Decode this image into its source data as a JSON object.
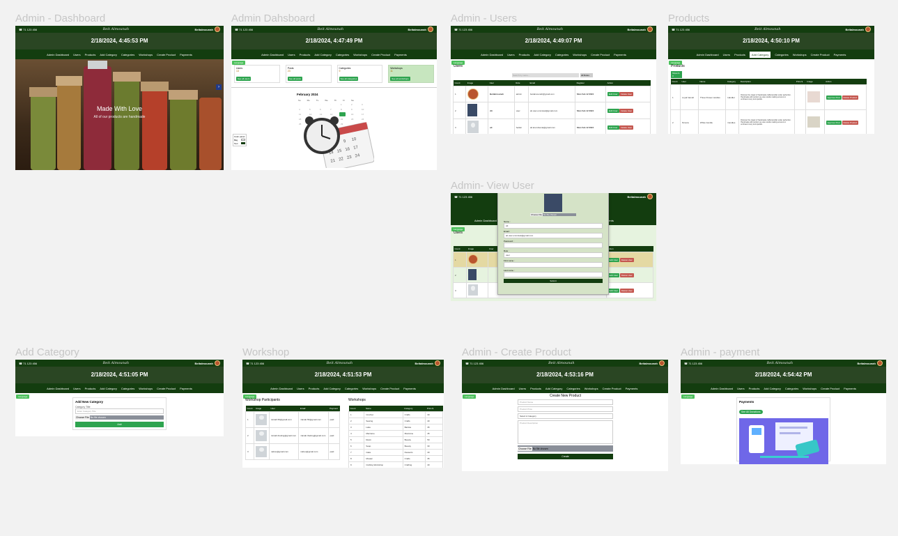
{
  "frames": {
    "dashboard": "Admin - Dashboard",
    "dahsboard": "Admin Dahsboard",
    "users": "Admin - Users",
    "products": "Products",
    "view_user": "Admin- View User",
    "add_category": "Add Category",
    "workshop": "Workshop",
    "create_product": "Admin - Create Product",
    "payment": "Admin - payment"
  },
  "common": {
    "phone": "71 123 456",
    "logo": "Beit Almounah",
    "username": "Beitalmounah",
    "lang": "Language"
  },
  "times": {
    "dashboard": "2/18/2024, 4:45:53 PM",
    "dahsboard": "2/18/2024, 4:47:49 PM",
    "users": "2/18/2024, 4:49:07 PM",
    "products": "2/18/2024, 4:50:10 PM",
    "add_category": "2/18/2024, 4:51:05 PM",
    "workshop": "2/18/2024, 4:51:53 PM",
    "create_product": "2/18/2024, 4:53:16 PM",
    "payment": "2/18/2024, 4:54:42 PM"
  },
  "nav": [
    "Admin Dashboard",
    "Users",
    "Products",
    "Add Category",
    "Categories",
    "Workshops",
    "Create Product",
    "Payments"
  ],
  "nav_alt_first": "Admin Dashboard",
  "hero": {
    "title": "Made With Love",
    "subtitle": "All of our products are handmade"
  },
  "stats": [
    {
      "label": "Users",
      "value": "13",
      "btn": "See all users"
    },
    {
      "label": "Posts",
      "value": "23",
      "btn": "See all posts"
    },
    {
      "label": "Categories",
      "value": "9",
      "btn": "See all categories"
    },
    {
      "label": "Workshops",
      "value": "11",
      "btn": "See all workshops"
    }
  ],
  "calendar": {
    "month": "February 2024",
    "days": [
      "Su",
      "Mo",
      "Tu",
      "We",
      "Th",
      "Fr",
      "Sa"
    ]
  },
  "color_panel": {
    "title": "Color panel",
    "rows": [
      "Bkg",
      "Text"
    ]
  },
  "users_page": {
    "heading": "Users",
    "search_placeholder": "Search by name...",
    "filter_btn": "All Roles",
    "columns": [
      "Count",
      "Image",
      "User",
      "Role",
      "Email",
      "Register",
      "Action"
    ],
    "rows": [
      {
        "count": "1",
        "user": "Beitalmounah",
        "role": "admin",
        "email": "beitalmounah@gmail.com",
        "date": "Mon Feb 12 2024"
      },
      {
        "count": "2",
        "user": "Ali",
        "role": "user",
        "email": "ali.user.emmstek@gmail.com",
        "date": "Mon Feb 12 2024"
      },
      {
        "count": "3",
        "user": "ali",
        "role": "helder",
        "email": "ali.lerel.dsenia@gmail.com",
        "date": "Mon Feb 12 2024"
      }
    ],
    "edit": "Edit User",
    "delete": "Delete User"
  },
  "products_page": {
    "heading": "Products",
    "show": "Show 0-3",
    "columns": [
      "Count",
      "User",
      "Name",
      "Category",
      "Description",
      "Price $",
      "Image",
      "Action"
    ],
    "rows": [
      {
        "count": "1",
        "user": "Loyal hamuh",
        "name": "Three Flower candles",
        "category": "Handler",
        "desc": "Discover the magic of handmade craftsmanship under perfection. Handmade with perfect soy wax candle making ensures to embrace luxury and sparkle."
      },
      {
        "count": "2",
        "user": "Nimora",
        "name": "White Candle",
        "category": "Candles",
        "desc": "Discover the magic of handmade craftsmanship under perfection. Handmade with perfect soy wax candle making ensures to embrace luxury and sparkle."
      }
    ],
    "approve": "Approve Post",
    "delete": "Delete Product"
  },
  "view_user": {
    "choose": "Choose File",
    "nofile": "No file chosen",
    "fields": [
      {
        "label": "Name :",
        "value": "Ali"
      },
      {
        "label": "Email :",
        "value": "ali.user.emmstek@gmail.com"
      },
      {
        "label": "Password :",
        "value": ""
      },
      {
        "label": "Role :",
        "value": "user"
      },
      {
        "label": "First name :",
        "value": ""
      },
      {
        "label": "Last name :",
        "value": ""
      }
    ],
    "submit": "Submit",
    "heading": "Users",
    "columns": [
      "Count",
      "Image",
      "User",
      "Action"
    ],
    "edit": "Edit User",
    "delete": "Delete User"
  },
  "add_category": {
    "title": "Add New Category",
    "label": "Category Title",
    "placeholder": "Enter Category Title",
    "choose": "Choose File",
    "nofile": "No file chosen",
    "add": "Add"
  },
  "workshop_page": {
    "participants_title": "Workshop Participants",
    "p_columns": [
      "Count",
      "Image",
      "User",
      "Email",
      "Payment"
    ],
    "p_rows": [
      {
        "count": "1",
        "user": "zainab.56@gmail.com",
        "email": "zainab.56@gmail.com",
        "pay": "paid"
      },
      {
        "count": "2",
        "user": "zainab.theking@gmail.com",
        "email": "zainab.theking@gmail.com",
        "pay": "paid"
      },
      {
        "count": "3",
        "user": "nabou@gmail.com",
        "email": "nabou@gmail.com",
        "pay": "paid"
      }
    ],
    "workshops_title": "Workshops",
    "w_columns": [
      "Count",
      "Name",
      "Category",
      "Price $"
    ],
    "w_rows": [
      {
        "count": "1",
        "name": "Crochet",
        "cat": "Crafts",
        "price": "30"
      },
      {
        "count": "2",
        "name": "Sewing",
        "cat": "Crafts",
        "price": "40"
      },
      {
        "count": "3",
        "name": "Latte",
        "cat": "Barista",
        "price": "35"
      },
      {
        "count": "4",
        "name": "Macrame",
        "cat": "Macrame",
        "price": "45"
      },
      {
        "count": "5",
        "name": "Resin",
        "cat": "Beauty",
        "price": "50"
      },
      {
        "count": "6",
        "name": "Soap",
        "cat": "Beauty",
        "price": "30"
      },
      {
        "count": "7",
        "name": "Cake",
        "cat": "Desserts",
        "price": "40"
      },
      {
        "count": "8",
        "name": "Mosaic",
        "cat": "Crafts",
        "price": "35"
      },
      {
        "count": "9",
        "name": "Crafting Workshop",
        "cat": "Crafting",
        "price": "40"
      }
    ]
  },
  "create_product": {
    "title": "Create New Product",
    "name_ph": "Product Name",
    "price_ph": "Product Price",
    "select": "Select A Category",
    "desc_ph": "Product Description",
    "choose": "Choose File",
    "nofile": "No file chosen",
    "create": "Create"
  },
  "payment_page": {
    "title": "Payments",
    "btn": "See All Donations"
  }
}
